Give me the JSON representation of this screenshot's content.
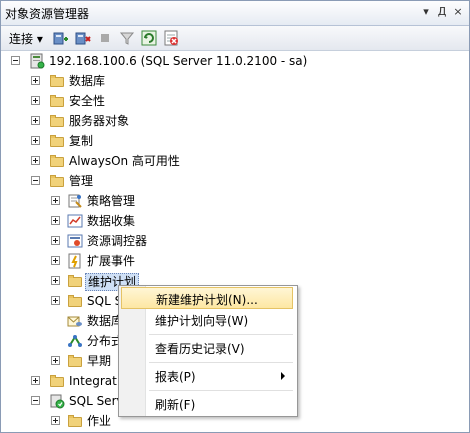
{
  "panel": {
    "title": "对象资源管理器",
    "title_buttons": {
      "dropdown": "▾",
      "pin": "Д",
      "close": "×"
    }
  },
  "toolbar": {
    "connect_label": "连接 ▾"
  },
  "tree": {
    "server": "192.168.100.6 (SQL Server 11.0.2100 - sa)",
    "databases": "数据库",
    "security": "安全性",
    "server_objects": "服务器对象",
    "replication": "复制",
    "alwayson": "AlwaysOn 高可用性",
    "management": "管理",
    "policy_management": "策略管理",
    "data_collection": "数据收集",
    "resource_governor": "资源调控器",
    "extended_events": "扩展事件",
    "maintenance_plans": "维护计划",
    "sql_server_logs": "SQL S",
    "db_mail": "数据库",
    "dtc": "分布式",
    "legacy": "早期",
    "integration": "Integratio",
    "sql_agent": "SQL Server",
    "jobs": "作业"
  },
  "context_menu": {
    "new_maintenance_plan": "新建维护计划(N)...",
    "maintenance_plan_wizard": "维护计划向导(W)",
    "view_history": "查看历史记录(V)",
    "reports": "报表(P)",
    "refresh": "刷新(F)"
  },
  "colors": {
    "selection": "#cfe0f6",
    "menu_highlight": "#fde7a3",
    "folder": "#f1d27a"
  }
}
